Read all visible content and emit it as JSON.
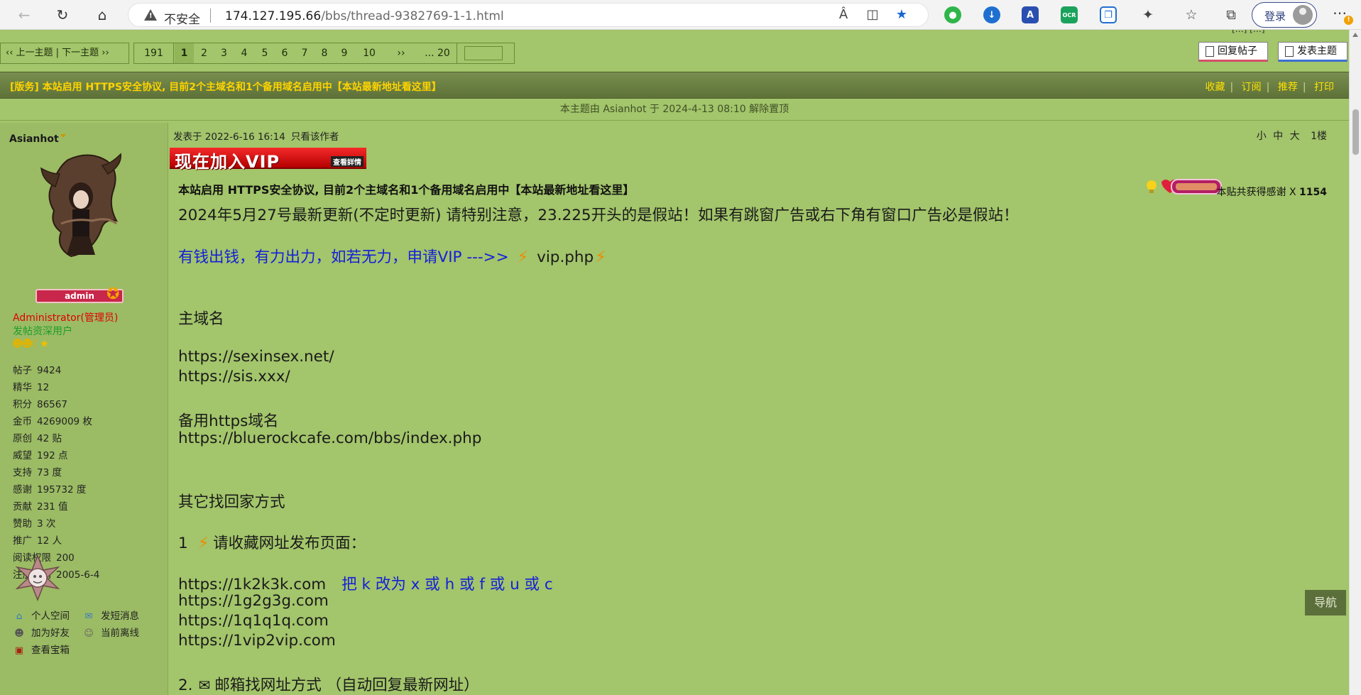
{
  "browser": {
    "insecure_label": "不安全",
    "url_host": "174.127.195.66",
    "url_path": "/bbs/thread-9382769-1-1.html",
    "login_label": "登录",
    "more_badge": "!"
  },
  "pager": {
    "prev_next": "‹‹ 上一主题 | 下一主题 ››",
    "total": "191",
    "pages": [
      "1",
      "2",
      "3",
      "4",
      "5",
      "6",
      "7",
      "8",
      "9",
      "10"
    ],
    "next": "››",
    "last": "... 20",
    "current": "1"
  },
  "actions": {
    "reply": "回复帖子",
    "new_topic": "发表主题"
  },
  "thread": {
    "title": "[版务] 本站启用 HTTPS安全协议, 目前2个主域名和1个备用域名启用中【本站最新地址看这里】",
    "tools": [
      "收藏",
      "订阅",
      "推荐",
      "打印"
    ],
    "notice": "本主题由 Asianhot 于 2024-4-13 08:10 解除置顶"
  },
  "user": {
    "name": "Asianhot",
    "badge": "admin",
    "role": "Administrator(管理员)",
    "group": "发帖资深用户",
    "stats": [
      {
        "k": "帖子",
        "v": "9424"
      },
      {
        "k": "精华",
        "v": "12"
      },
      {
        "k": "积分",
        "v": "86567"
      },
      {
        "k": "金币",
        "v": "4269009 枚"
      },
      {
        "k": "原创",
        "v": "42 贴"
      },
      {
        "k": "威望",
        "v": "192 点"
      },
      {
        "k": "支持",
        "v": "73 度"
      },
      {
        "k": "感谢",
        "v": "195732 度"
      },
      {
        "k": "贡献",
        "v": "231 值"
      },
      {
        "k": "赞助",
        "v": "3 次"
      },
      {
        "k": "推广",
        "v": "12 人"
      },
      {
        "k": "阅读权限",
        "v": "200"
      },
      {
        "k": "注册时间",
        "v": "2005-6-4"
      }
    ],
    "links": {
      "space": "个人空间",
      "pm": "发短消息",
      "friend": "加为好友",
      "status": "当前离线",
      "box": "查看宝箱"
    }
  },
  "post": {
    "meta": "发表于 2022-6-16 16:14",
    "only_author": "只看该作者",
    "font_small": "小",
    "font_mid": "中",
    "font_large": "大",
    "floor": "1楼",
    "vip_banner": "现在加入VIP",
    "vip_sub": "查看詳情",
    "subject": "本站启用 HTTPS安全协议, 目前2个主域名和1个备用域名启用中【本站最新地址看这里】",
    "thanks_prefix": "本贴共获得感谢 X",
    "thanks_count": "1154",
    "line_update": "2024年5月27号最新更新(不定时更新) 请特别注意，23.225开头的是假站！如果有跳窗广告或右下角有窗口广告必是假站！",
    "line_vip": "有钱出钱，有力出力，如若无力，申请VIP --->>",
    "line_vip_link": "vip.php",
    "h_main": "主域名",
    "main1": "https://sexinsex.net/",
    "main2": "https://sis.xxx/",
    "h_backup": "备用https域名",
    "backup1": "https://bluerockcafe.com/bbs/index.php",
    "h_other": "其它找回家方式",
    "item1_num": "1",
    "item1": "请收藏网址发布页面：",
    "pub1": "https://1k2k3k.com",
    "pub1_note": "把 k 改为 x 或 h 或 f 或 u 或 c",
    "pub2": "https://1g2g3g.com",
    "pub3": "https://1q1q1q.com",
    "pub4": "https://1vip2vip.com",
    "item2_num": "2.",
    "item2": "邮箱找网址方式 （自动回复最新网址）"
  },
  "guide": "导航"
}
